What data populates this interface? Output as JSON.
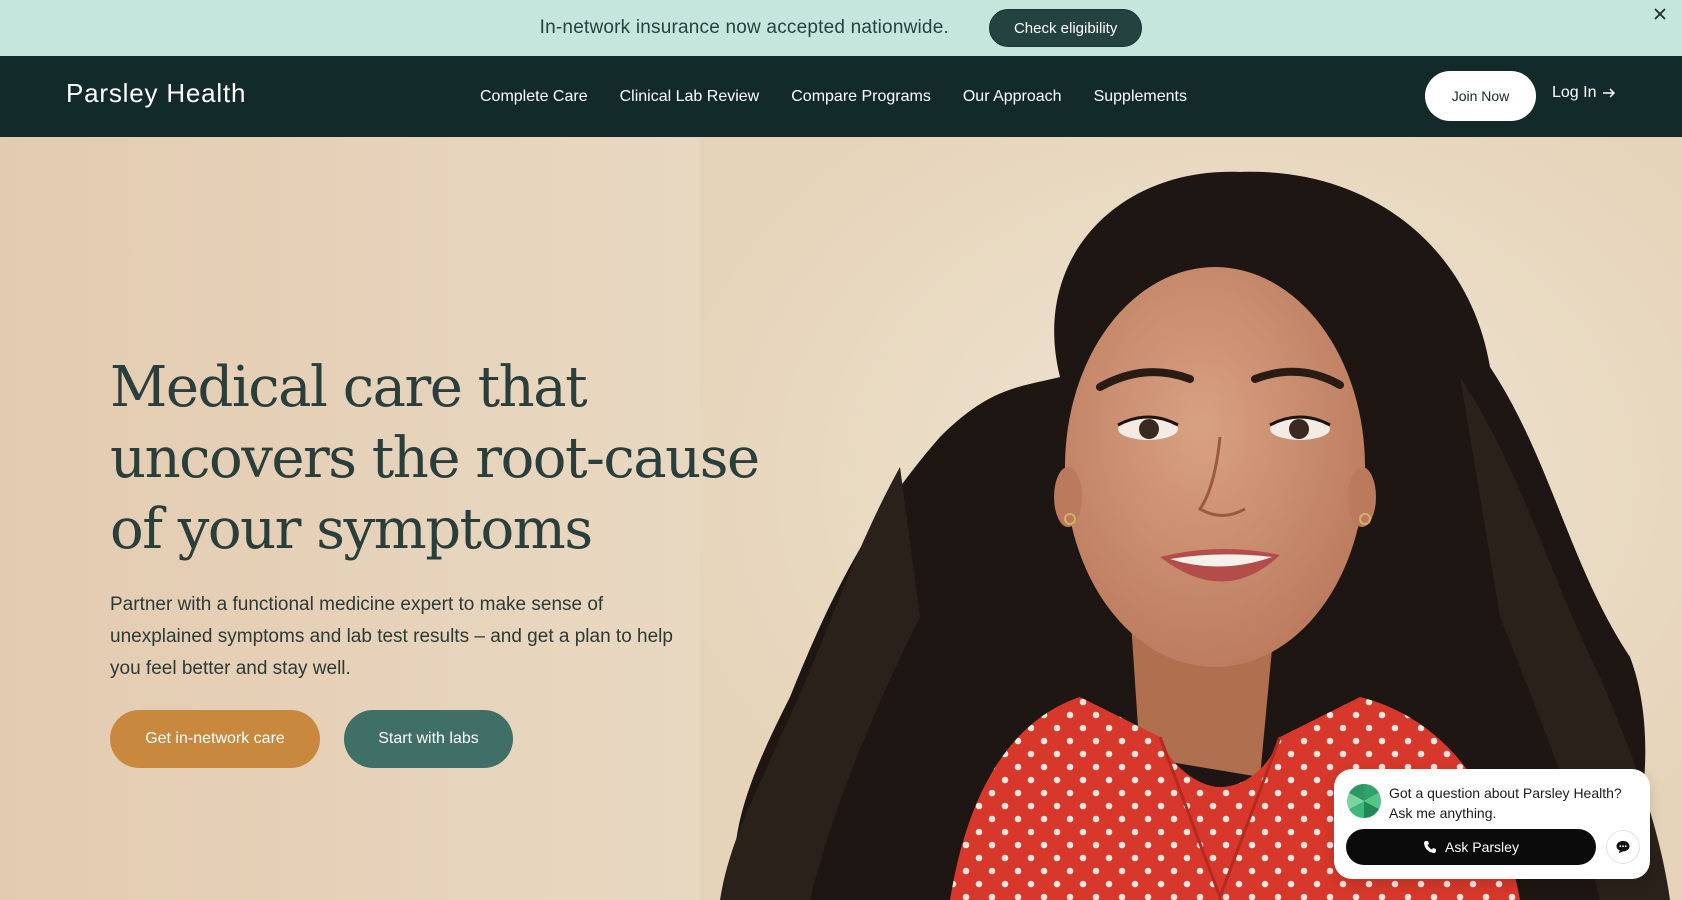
{
  "announcement": {
    "text": "In-network insurance now accepted nationwide.",
    "button_label": "Check eligibility",
    "close_icon": "close-icon"
  },
  "nav": {
    "logo": "Parsley Health",
    "links": [
      "Complete Care",
      "Clinical Lab Review",
      "Compare Programs",
      "Our Approach",
      "Supplements"
    ],
    "join_label": "Join Now",
    "login_label": "Log In",
    "login_icon": "arrow-right-icon"
  },
  "hero": {
    "headline": "Medical care that uncovers the root-cause of your symptoms",
    "subtext": "Partner with a functional medicine expert to make sense of unexplained symptoms and lab test results – and get a plan to help you feel better and stay well.",
    "primary_cta": "Get in-network care",
    "secondary_cta": "Start with labs"
  },
  "chat": {
    "question": "Got a question about Parsley Health? Ask me anything.",
    "ask_label": "Ask Parsley",
    "avatar_icon": "parsley-logo-icon",
    "phone_icon": "phone-icon",
    "message_icon": "chat-bubble-icon"
  },
  "colors": {
    "announce_bg": "#c4e6dc",
    "nav_bg": "#132a2b",
    "primary_cta": "#c8893f",
    "secondary_cta": "#3f6f66",
    "headline": "#2a3f3b"
  }
}
